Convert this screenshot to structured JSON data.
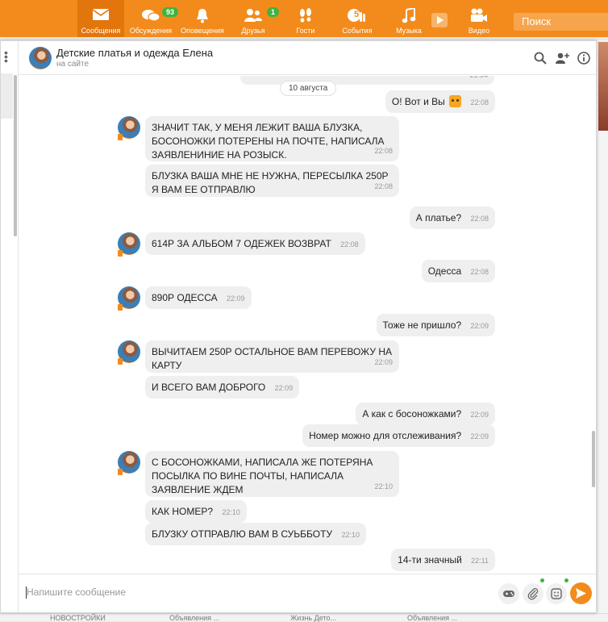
{
  "nav": {
    "items": [
      {
        "label": "Сообщения",
        "icon": "envelope-icon"
      },
      {
        "label": "Обсуждения",
        "icon": "discussions-icon",
        "badge": "93"
      },
      {
        "label": "Оповещения",
        "icon": "bell-icon"
      },
      {
        "label": "Друзья",
        "icon": "friends-icon",
        "badge": "1"
      },
      {
        "label": "Гости",
        "icon": "footprints-icon"
      },
      {
        "label": "События",
        "icon": "events-icon",
        "badge_inline": "5"
      },
      {
        "label": "Музыка",
        "icon": "music-note-icon"
      },
      {
        "label": "Видео",
        "icon": "video-camera-icon"
      }
    ],
    "search_placeholder": "Поиск",
    "accent": "#f28b1c"
  },
  "chat": {
    "contact_name": "Детские платья и одежда Елена",
    "contact_status": "на сайте",
    "date_divider": "10 августа",
    "prev_time": "21:54",
    "messages": [
      {
        "side": "out",
        "text": "О! Вот и Вы",
        "time": "22:08",
        "emoji": "cat-emoji-icon"
      },
      {
        "side": "in",
        "text": "ЗНАЧИТ ТАК, У МЕНЯ ЛЕЖИТ ВАША БЛУЗКА, БОСОНОЖКИ ПОТЕРЕНЫ НА ПОЧТЕ, НАПИСАЛА ЗАЯВЛЕНИНИЕ НА РОЗЫСК.",
        "time": "22:08"
      },
      {
        "side": "in",
        "text": "БЛУЗКА ВАША МНЕ НЕ НУЖНА, ПЕРЕСЫЛКА 250Р Я ВАМ ЕЕ ОТПРАВЛЮ",
        "time": "22:08"
      },
      {
        "side": "out",
        "text": "А платье?",
        "time": "22:08"
      },
      {
        "side": "in",
        "text": "614Р  ЗА АЛЬБОМ 7 ОДЕЖЕК ВОЗВРАТ",
        "time": "22:08"
      },
      {
        "side": "out",
        "text": "Одесса",
        "time": "22:08"
      },
      {
        "side": "in",
        "text": "890Р ОДЕССА",
        "time": "22:09"
      },
      {
        "side": "out",
        "text": "Тоже не пришло?",
        "time": "22:09"
      },
      {
        "side": "in",
        "text": "ВЫЧИТАЕМ 250Р ОСТАЛЬНОЕ ВАМ ПЕРЕВОЖУ НА КАРТУ",
        "time": "22:09"
      },
      {
        "side": "in",
        "text": "И ВСЕГО ВАМ ДОБРОГО",
        "time": "22:09"
      },
      {
        "side": "out",
        "text": "А как с босоножками?",
        "time": "22:09"
      },
      {
        "side": "out",
        "text": "Номер можно для отслеживания?",
        "time": "22:09"
      },
      {
        "side": "in",
        "text": "С БОСОНОЖКАМИ, НАПИСАЛА ЖЕ ПОТЕРЯНА ПОСЫЛКА ПО ВИНЕ ПОЧТЫ, НАПИСАЛА ЗАЯВЛЕНИЕ ЖДЕМ",
        "time": "22:10"
      },
      {
        "side": "in",
        "text": "КАК НОМЕР?",
        "time": "22:10"
      },
      {
        "side": "in",
        "text": "БЛУЗКУ ОТПРАВЛЮ ВАМ В СУЬББОТУ",
        "time": "22:10"
      },
      {
        "side": "out",
        "text": "14-ти значный",
        "time": "22:11"
      }
    ],
    "composer_placeholder": "Напишите сообщение"
  },
  "background_footer": [
    "НОВОСТРОЙКИ",
    "Объявления ...",
    "Жизнь Дето...",
    "Объявления ..."
  ]
}
